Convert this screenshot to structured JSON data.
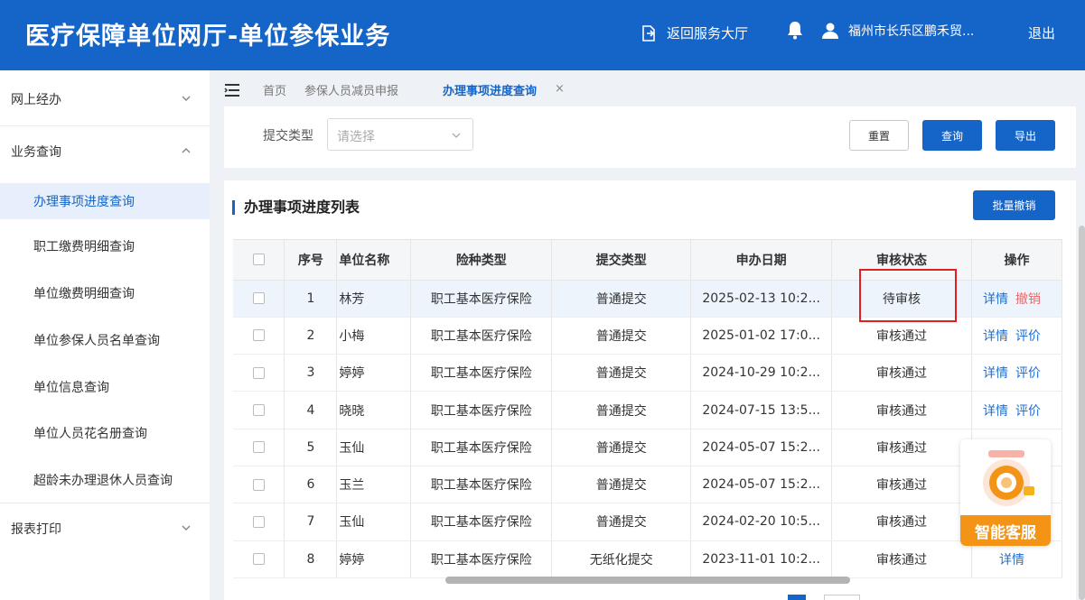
{
  "header": {
    "title": "医疗保障单位网厅-单位参保业务",
    "back_label": "返回服务大厅",
    "user_name": "福州市长乐区鹏禾贸...",
    "logout_label": "退出"
  },
  "sidebar": {
    "groups": [
      {
        "label": "网上经办"
      },
      {
        "label": "业务查询"
      },
      {
        "label": "报表打印"
      }
    ],
    "items": [
      {
        "label": "办理事项进度查询"
      },
      {
        "label": "职工缴费明细查询"
      },
      {
        "label": "单位缴费明细查询"
      },
      {
        "label": "单位参保人员名单查询"
      },
      {
        "label": "单位信息查询"
      },
      {
        "label": "单位人员花名册查询"
      },
      {
        "label": "超龄未办理退休人员查询"
      }
    ]
  },
  "tabs": {
    "home": "首页",
    "reduce": "参保人员减员申报",
    "progress": "办理事项进度查询",
    "close": "×"
  },
  "filter": {
    "label": "提交类型",
    "placeholder": "请选择",
    "reset": "重置",
    "query": "查询",
    "export": "导出"
  },
  "table_panel": {
    "title": "办理事项进度列表",
    "batch_cancel": "批量撤销"
  },
  "table": {
    "headers": {
      "seq": "序号",
      "name": "单位名称",
      "insurance": "险种类型",
      "submit_type": "提交类型",
      "date": "申办日期",
      "status": "审核状态",
      "ops": "操作"
    },
    "rows": [
      {
        "seq": "1",
        "name": "林芳",
        "insurance": "职工基本医疗保险",
        "submit_type": "普通提交",
        "date": "2025-02-13 10:2...",
        "status": "待审核",
        "op1": "详情",
        "op2": "撤销"
      },
      {
        "seq": "2",
        "name": "小梅",
        "insurance": "职工基本医疗保险",
        "submit_type": "普通提交",
        "date": "2025-01-02 17:0...",
        "status": "审核通过",
        "op1": "详情",
        "op2": "评价"
      },
      {
        "seq": "3",
        "name": "婷婷",
        "insurance": "职工基本医疗保险",
        "submit_type": "普通提交",
        "date": "2024-10-29 10:2...",
        "status": "审核通过",
        "op1": "详情",
        "op2": "评价"
      },
      {
        "seq": "4",
        "name": "晓晓",
        "insurance": "职工基本医疗保险",
        "submit_type": "普通提交",
        "date": "2024-07-15 13:5...",
        "status": "审核通过",
        "op1": "详情",
        "op2": "评价"
      },
      {
        "seq": "5",
        "name": "玉仙",
        "insurance": "职工基本医疗保险",
        "submit_type": "普通提交",
        "date": "2024-05-07 15:2...",
        "status": "审核通过",
        "op1": "",
        "op2": ""
      },
      {
        "seq": "6",
        "name": "玉兰",
        "insurance": "职工基本医疗保险",
        "submit_type": "普通提交",
        "date": "2024-05-07 15:2...",
        "status": "审核通过",
        "op1": "",
        "op2": ""
      },
      {
        "seq": "7",
        "name": "玉仙",
        "insurance": "职工基本医疗保险",
        "submit_type": "普通提交",
        "date": "2024-02-20 10:5...",
        "status": "审核通过",
        "op1": "",
        "op2": ""
      },
      {
        "seq": "8",
        "name": "婷婷",
        "insurance": "职工基本医疗保险",
        "submit_type": "无纸化提交",
        "date": "2023-11-01 10:2...",
        "status": "审核通过",
        "op1": "详情",
        "op2": ""
      }
    ]
  },
  "chat_widget": {
    "label": "智能客服"
  },
  "colors": {
    "primary": "#1565c9",
    "danger": "#e86a6a",
    "chat": "#f39417"
  }
}
